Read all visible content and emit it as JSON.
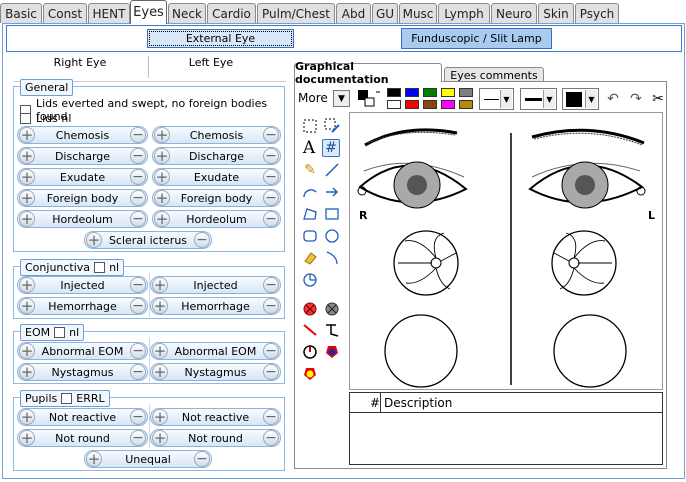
{
  "tabs": [
    "Basic",
    "Const",
    "HENT",
    "Eyes",
    "Neck",
    "Cardio",
    "Pulm/Chest",
    "Abd",
    "GU",
    "Musc",
    "Lymph",
    "Neuro",
    "Skin",
    "Psych"
  ],
  "subtabs": {
    "external": "External Eye",
    "fundus": "Funduscopic / Slit Lamp"
  },
  "columns": {
    "right": "Right Eye",
    "left": "Left Eye"
  },
  "general": {
    "label": "General",
    "lids_everted": "Lids everted and swept, no foreign bodies found",
    "lids_nl": "Lids nl",
    "rows": [
      "Chemosis",
      "Discharge",
      "Exudate",
      "Foreign body",
      "Hordeolum"
    ],
    "single": "Scleral icterus"
  },
  "conjunctiva": {
    "label": "Conjunctiva",
    "nl": "nl",
    "rows": [
      "Injected",
      "Hemorrhage"
    ]
  },
  "eom": {
    "label": "EOM",
    "nl": "nl",
    "rows": [
      "Abnormal EOM",
      "Nystagmus"
    ]
  },
  "pupils": {
    "label": "Pupils",
    "errl": "ERRL",
    "rows": [
      "Not reactive",
      "Not round"
    ],
    "single": "Unequal"
  },
  "graphical": {
    "tab_active": "Graphical documentation",
    "tab_inactive": "Eyes comments",
    "more": "More",
    "R": "R",
    "L": "L"
  },
  "description": {
    "num": "#",
    "header": "Description"
  },
  "palette": [
    "#000000",
    "#ffffff",
    "#0000ff",
    "#ff0000",
    "#008000",
    "#8b4513",
    "#ffff00",
    "#ff00ff",
    "#808080",
    "#b8860b"
  ]
}
